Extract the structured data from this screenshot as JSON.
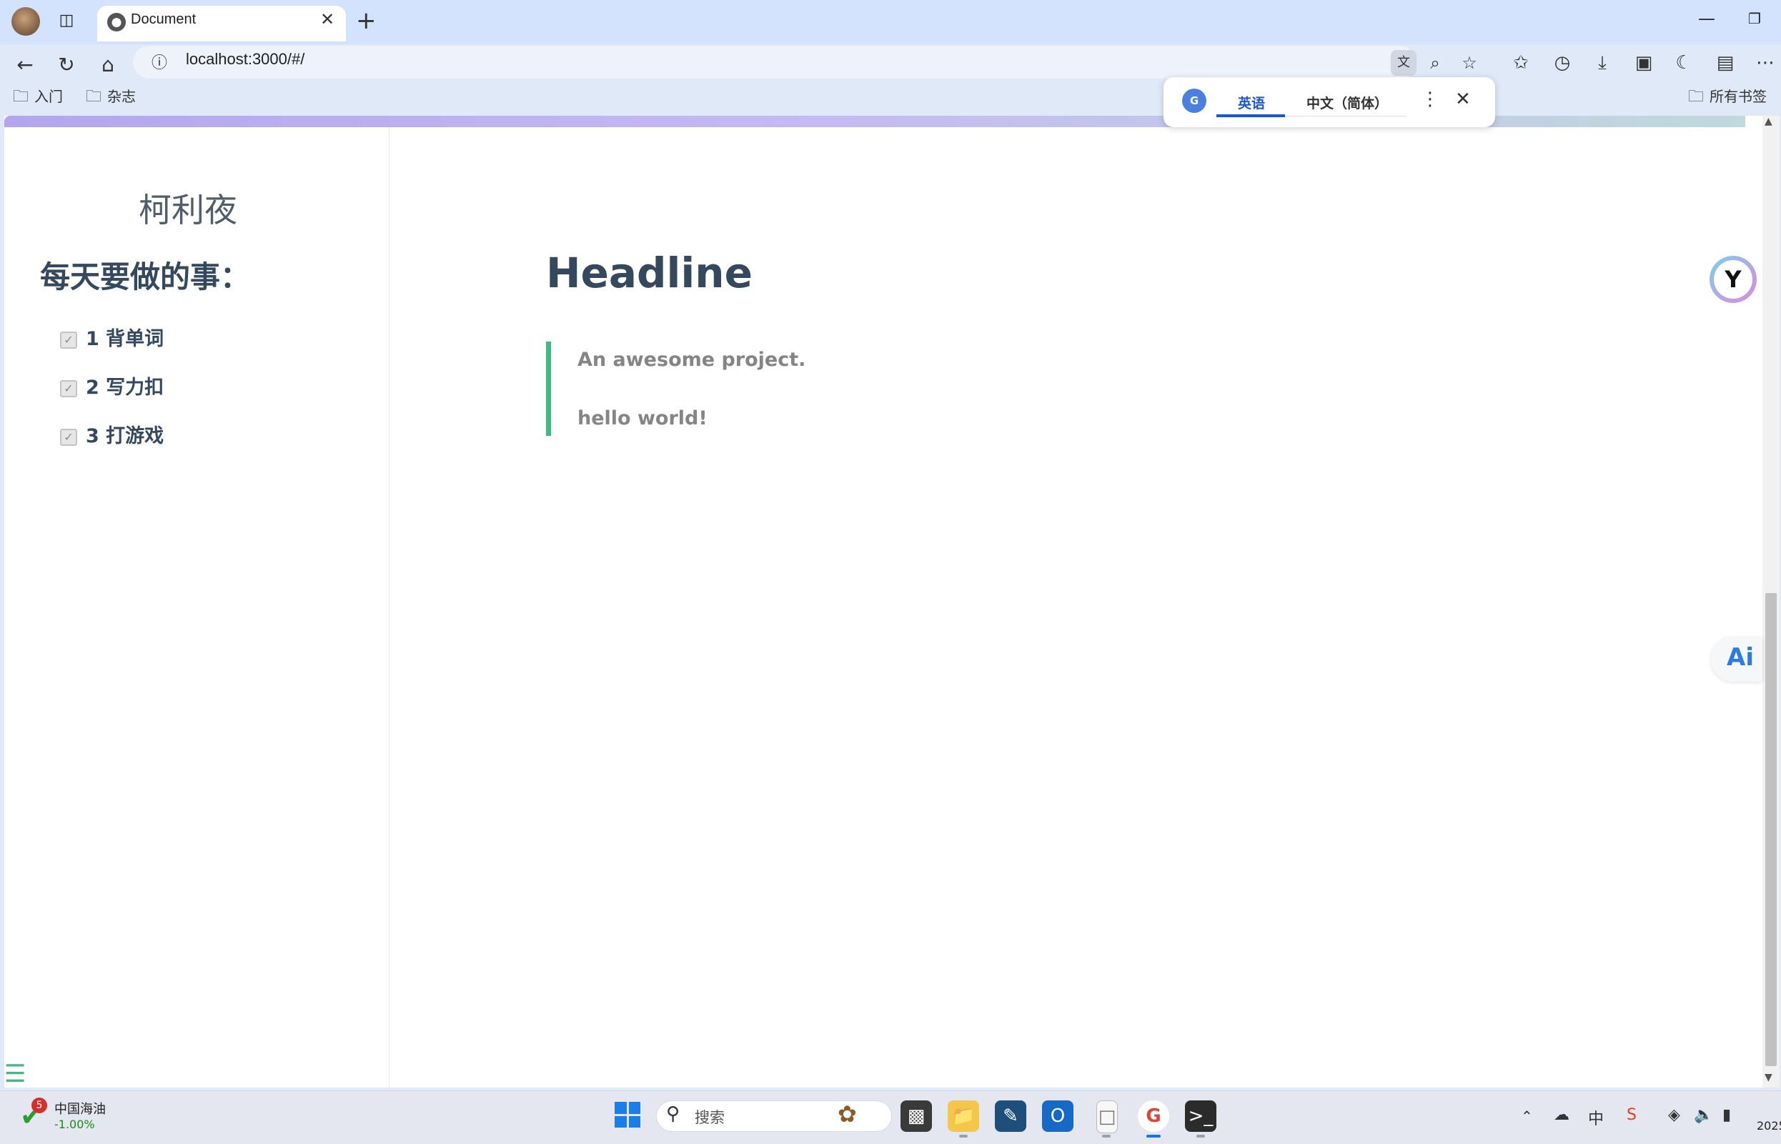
{
  "browser": {
    "tab_title": "Document",
    "url": "localhost:3000/#/",
    "bookmarks": [
      {
        "label": "入门"
      },
      {
        "label": "杂志"
      }
    ],
    "all_bookmarks_label": "所有书签"
  },
  "translate_popup": {
    "source_lang": "英语",
    "target_lang": "中文（简体）",
    "logo_text": "G"
  },
  "sidebar": {
    "app_name": "柯利夜",
    "todo_title": "每天要做的事：",
    "todos": [
      {
        "label": "1 背单词",
        "checked": true
      },
      {
        "label": "2 写力扣",
        "checked": true
      },
      {
        "label": "3 打游戏",
        "checked": true
      }
    ]
  },
  "main": {
    "headline": "Headline",
    "quote_lines": [
      "An awesome project.",
      "hello world!"
    ]
  },
  "widgets": {
    "ai_label": "Ai"
  },
  "taskbar": {
    "stock_badge": "5",
    "stock_name": "中国海油",
    "stock_change": "-1.00%",
    "search_placeholder": "搜索",
    "clock_partial": "2025"
  },
  "colors": {
    "accent_green": "#42b983",
    "heading": "#34495e",
    "quote_text": "#858585",
    "translate_blue": "#1a56d6"
  }
}
